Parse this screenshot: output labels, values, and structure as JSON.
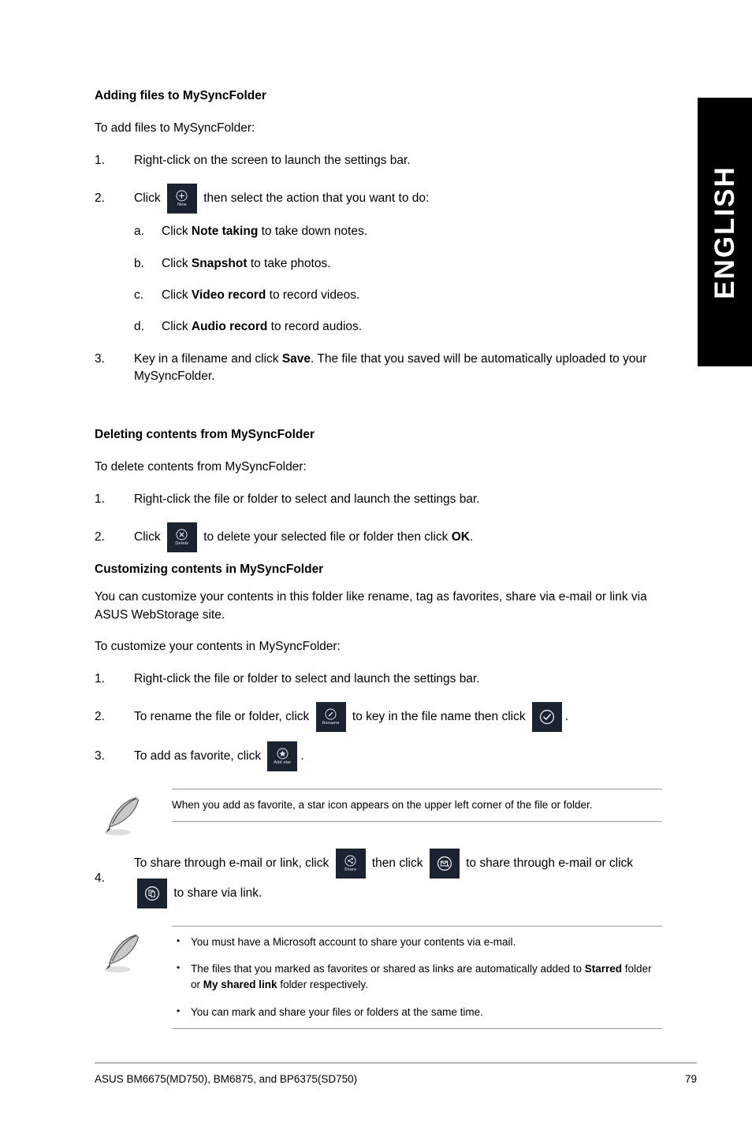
{
  "language_tab": {
    "label": "ENGLISH"
  },
  "sections": [
    {
      "heading": "Adding files to MySyncFolder",
      "intro": "To add files to MySyncFolder:",
      "steps": [
        {
          "marker": "1.",
          "text": "Right-click on the screen to launch the settings bar."
        },
        {
          "marker": "2.",
          "pre": "Click",
          "icon": "new-icon",
          "post": "then select the action that you want to do:"
        },
        {
          "marker": "3.",
          "pre": "Key in a filename and click ",
          "bold": "Save",
          "post": ". The file that you saved will be automatically uploaded to your MySyncFolder."
        }
      ],
      "substeps": [
        {
          "marker": "a.",
          "pre": "Click ",
          "bold": "Note taking",
          "post": " to take down notes."
        },
        {
          "marker": "b.",
          "pre": "Click ",
          "bold": "Snapshot",
          "post": " to take photos."
        },
        {
          "marker": "c.",
          "pre": "Click ",
          "bold": "Video record",
          "post": " to record videos."
        },
        {
          "marker": "d.",
          "pre": "Click ",
          "bold": "Audio record",
          "post": " to record audios."
        }
      ]
    },
    {
      "heading": "Deleting contents from MySyncFolder",
      "intro": "To delete contents from MySyncFolder:",
      "steps": [
        {
          "marker": "1.",
          "text": "Right-click the file or folder to select and launch the settings bar."
        },
        {
          "marker": "2.",
          "pre": "Click",
          "icon": "delete-icon",
          "post": "to delete your selected file or folder then click ",
          "bold": "OK",
          "tail": "."
        }
      ]
    },
    {
      "heading": "Customizing contents in MySyncFolder",
      "body": "You can customize your contents in this folder like rename, tag as favorites, share via e-mail or link via ASUS WebStorage site.",
      "intro": "To customize your contents in MySyncFolder:",
      "steps": [
        {
          "marker": "1.",
          "text": "Right-click the file or folder to select and launch the settings bar."
        },
        {
          "marker": "2.",
          "pre": "To rename the file or folder, click",
          "icon": "rename-icon",
          "mid": "to key in the file name then click",
          "icon2": "confirm-icon",
          "tail": "."
        },
        {
          "marker": "3.",
          "pre": "To add as favorite, click",
          "icon": "add-star-icon",
          "tail": "."
        },
        {
          "marker": "4.",
          "pre": "To share through e-mail or link, click",
          "icon": "share-icon",
          "mid": "then click",
          "icon2": "email-icon",
          "post": "to share through e-mail or click",
          "icon3": "link-icon",
          "tail": "to share via link."
        }
      ]
    }
  ],
  "notes": [
    {
      "icon": "quill-icon",
      "text": "When you add as favorite, a star icon appears on the upper left corner of the file or folder."
    },
    {
      "icon": "quill-icon",
      "bullets": [
        {
          "text": "You must have a Microsoft account to share your contents via e-mail."
        },
        {
          "pre": "The files that you marked as favorites or shared as links are automatically added to ",
          "bold1": "Starred",
          "mid": " folder or ",
          "bold2": "My shared link",
          "post": " folder respectively."
        },
        {
          "text": "You can mark and share your files or folders at the same time."
        }
      ]
    }
  ],
  "icon_labels": {
    "new": "New",
    "delete": "Delete",
    "rename": "Rename",
    "add_star": "Add star",
    "share": "Share"
  },
  "footer": {
    "model_text": "ASUS BM6675(MD750), BM6875, and BP6375(SD750)",
    "page_number": "79"
  },
  "colors": {
    "tile_background": "#1b2230",
    "tile_foreground": "#e9ecf2",
    "tab_background": "#000000",
    "tab_text": "#ffffff",
    "rule": "#9a9a9a"
  }
}
